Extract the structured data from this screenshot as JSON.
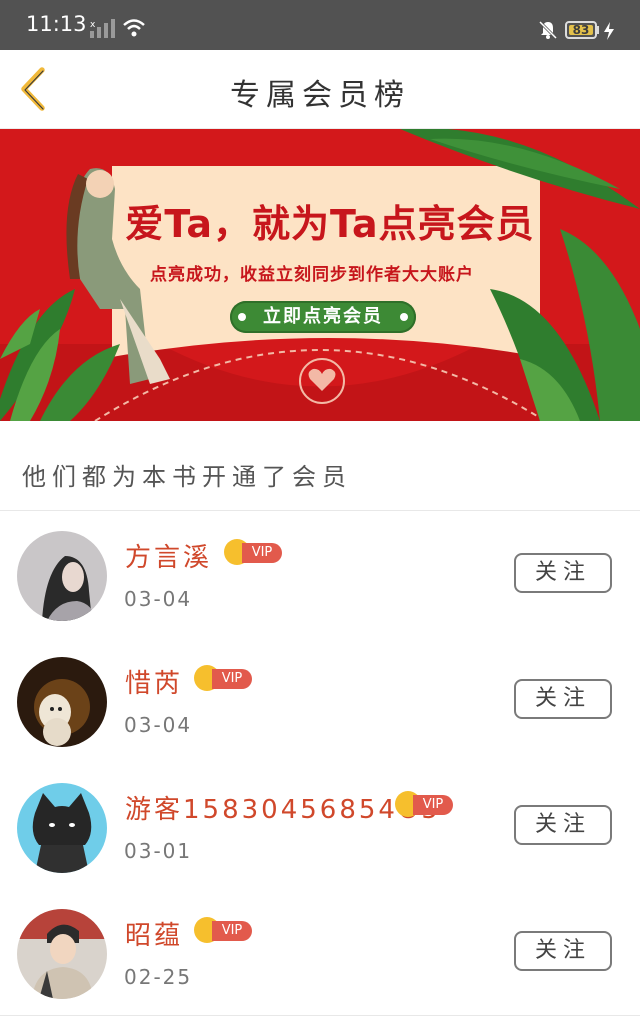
{
  "status_bar": {
    "time": "11:13",
    "battery": "83",
    "icons": [
      "signal-icon",
      "wifi-icon",
      "mute-bell-icon",
      "battery-icon",
      "charging-bolt-icon"
    ]
  },
  "nav": {
    "back_icon": "chevron-left-icon",
    "title": "专属会员榜"
  },
  "banner": {
    "headline": "爱Ta，就为Ta点亮会员",
    "subtitle": "点亮成功，收益立刻同步到作者大大账户",
    "button_label": "立即点亮会员",
    "colors": {
      "background": "#d3181b",
      "card": "#fde3c5",
      "button": "#3d8a35"
    }
  },
  "section": {
    "title": "他们都为本书开通了会员"
  },
  "members": [
    {
      "name": "方言溪",
      "vip": "VIP",
      "date": "03-04",
      "follow_label": "关注"
    },
    {
      "name": "惜芮",
      "vip": "VIP",
      "date": "03-04",
      "follow_label": "关注"
    },
    {
      "name": "游客15830456854O5",
      "vip": "VIP",
      "date": "03-01",
      "follow_label": "关注"
    },
    {
      "name": "昭蕴",
      "vip": "VIP",
      "date": "02-25",
      "follow_label": "关注"
    }
  ],
  "colors": {
    "accent_name": "#d0482b",
    "vip_tag": "#e25a4c",
    "vip_crown": "#f6bf2d"
  }
}
